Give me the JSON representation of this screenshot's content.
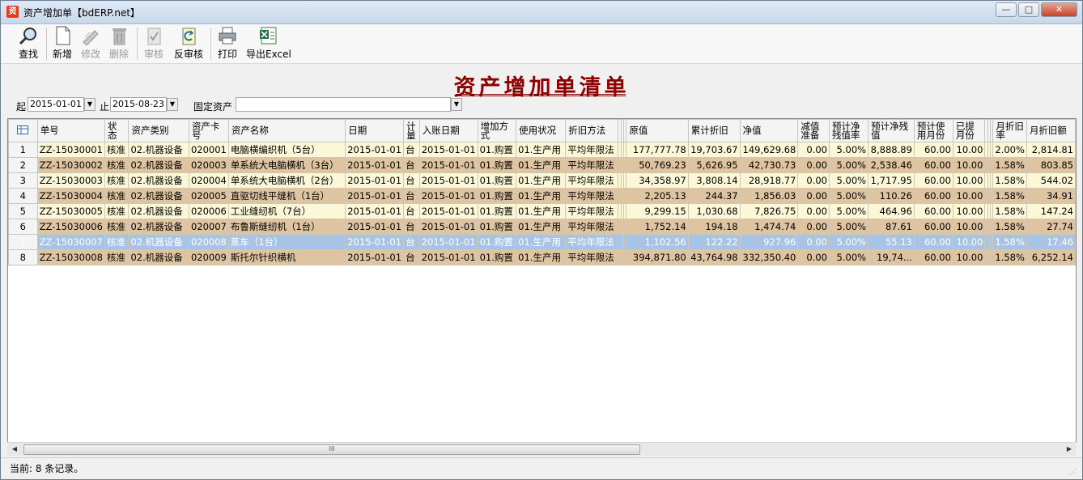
{
  "window": {
    "title": "资产增加单【bdERP.net】",
    "app_icon": "资"
  },
  "toolbar": {
    "search": "查找",
    "new": "新增",
    "edit": "修改",
    "delete": "删除",
    "audit": "审核",
    "unaudit": "反审核",
    "print": "打印",
    "export": "导出Excel"
  },
  "page_title": "资产增加单清单",
  "filter": {
    "from_label": "起",
    "from_value": "2015-01-01",
    "to_label": "止",
    "to_value": "2015-08-23",
    "asset_label": "固定资产",
    "asset_value": ""
  },
  "table": {
    "headers": {
      "no": "单号",
      "status": "状态",
      "category": "资产类别",
      "card": "资产卡号",
      "name": "资产名称",
      "date": "日期",
      "unit": "计量",
      "post_date": "入账日期",
      "method": "增加方式",
      "use_status": "使用状况",
      "depr_method": "折旧方法",
      "orig": "原值",
      "accum": "累计折旧",
      "net": "净值",
      "impair": "减值准备",
      "res_rate": "预计净残值率",
      "res_val": "预计净残值",
      "months": "预计使用月份",
      "used": "已提月份",
      "mrate": "月折旧率",
      "mamt": "月折旧额"
    },
    "rows": [
      {
        "idx": "1",
        "no": "ZZ-15030001",
        "status": "核准",
        "category": "02.机器设备",
        "card": "020001",
        "name": "电脑横编织机（5台）",
        "date": "2015-01-01",
        "unit": "台",
        "post_date": "2015-01-01",
        "method": "01.购置",
        "use_status": "01.生产用",
        "depr_method": "平均年限法",
        "orig": "177,777.78",
        "accum": "19,703.67",
        "net": "149,629.68",
        "impair": "0.00",
        "res_rate": "5.00%",
        "res_val": "8,888.89",
        "months": "60.00",
        "used": "10.00",
        "mrate": "2.00%",
        "mamt": "2,814.81",
        "style": "light"
      },
      {
        "idx": "2",
        "no": "ZZ-15030002",
        "status": "核准",
        "category": "02.机器设备",
        "card": "020003",
        "name": "单系统大电脑横机（3台）",
        "date": "2015-01-01",
        "unit": "台",
        "post_date": "2015-01-01",
        "method": "01.购置",
        "use_status": "01.生产用",
        "depr_method": "平均年限法",
        "orig": "50,769.23",
        "accum": "5,626.95",
        "net": "42,730.73",
        "impair": "0.00",
        "res_rate": "5.00%",
        "res_val": "2,538.46",
        "months": "60.00",
        "used": "10.00",
        "mrate": "1.58%",
        "mamt": "803.85",
        "style": "dark"
      },
      {
        "idx": "3",
        "no": "ZZ-15030003",
        "status": "核准",
        "category": "02.机器设备",
        "card": "020004",
        "name": "单系统大电脑横机（2台）",
        "date": "2015-01-01",
        "unit": "台",
        "post_date": "2015-01-01",
        "method": "01.购置",
        "use_status": "01.生产用",
        "depr_method": "平均年限法",
        "orig": "34,358.97",
        "accum": "3,808.14",
        "net": "28,918.77",
        "impair": "0.00",
        "res_rate": "5.00%",
        "res_val": "1,717.95",
        "months": "60.00",
        "used": "10.00",
        "mrate": "1.58%",
        "mamt": "544.02",
        "style": "light"
      },
      {
        "idx": "4",
        "no": "ZZ-15030004",
        "status": "核准",
        "category": "02.机器设备",
        "card": "020005",
        "name": "直驱切线平缝机（1台）",
        "date": "2015-01-01",
        "unit": "台",
        "post_date": "2015-01-01",
        "method": "01.购置",
        "use_status": "01.生产用",
        "depr_method": "平均年限法",
        "orig": "2,205.13",
        "accum": "244.37",
        "net": "1,856.03",
        "impair": "0.00",
        "res_rate": "5.00%",
        "res_val": "110.26",
        "months": "60.00",
        "used": "10.00",
        "mrate": "1.58%",
        "mamt": "34.91",
        "style": "dark"
      },
      {
        "idx": "5",
        "no": "ZZ-15030005",
        "status": "核准",
        "category": "02.机器设备",
        "card": "020006",
        "name": "工业缝纫机（7台）",
        "date": "2015-01-01",
        "unit": "台",
        "post_date": "2015-01-01",
        "method": "01.购置",
        "use_status": "01.生产用",
        "depr_method": "平均年限法",
        "orig": "9,299.15",
        "accum": "1,030.68",
        "net": "7,826.75",
        "impair": "0.00",
        "res_rate": "5.00%",
        "res_val": "464.96",
        "months": "60.00",
        "used": "10.00",
        "mrate": "1.58%",
        "mamt": "147.24",
        "style": "light"
      },
      {
        "idx": "6",
        "no": "ZZ-15030006",
        "status": "核准",
        "category": "02.机器设备",
        "card": "020007",
        "name": "布鲁斯缝纫机（1台）",
        "date": "2015-01-01",
        "unit": "台",
        "post_date": "2015-01-01",
        "method": "01.购置",
        "use_status": "01.生产用",
        "depr_method": "平均年限法",
        "orig": "1,752.14",
        "accum": "194.18",
        "net": "1,474.74",
        "impair": "0.00",
        "res_rate": "5.00%",
        "res_val": "87.61",
        "months": "60.00",
        "used": "10.00",
        "mrate": "1.58%",
        "mamt": "27.74",
        "style": "dark"
      },
      {
        "idx": "7",
        "no": "ZZ-15030007",
        "status": "核准",
        "category": "02.机器设备",
        "card": "020008",
        "name": "蒸车（1台）",
        "date": "2015-01-01",
        "unit": "台",
        "post_date": "2015-01-01",
        "method": "01.购置",
        "use_status": "01.生产用",
        "depr_method": "平均年限法",
        "orig": "1,102.56",
        "accum": "122.22",
        "net": "927.96",
        "impair": "0.00",
        "res_rate": "5.00%",
        "res_val": "55.13",
        "months": "60.00",
        "used": "10.00",
        "mrate": "1.58%",
        "mamt": "17.46",
        "style": "sel"
      },
      {
        "idx": "8",
        "no": "ZZ-15030008",
        "status": "核准",
        "category": "02.机器设备",
        "card": "020009",
        "name": "斯托尔针织横机",
        "date": "2015-01-01",
        "unit": "台",
        "post_date": "2015-01-01",
        "method": "01.购置",
        "use_status": "01.生产用",
        "depr_method": "平均年限法",
        "orig": "394,871.80",
        "accum": "43,764.98",
        "net": "332,350.40",
        "impair": "0.00",
        "res_rate": "5.00%",
        "res_val": "19,74...",
        "months": "60.00",
        "used": "10.00",
        "mrate": "1.58%",
        "mamt": "6,252.14",
        "style": "dark"
      }
    ]
  },
  "scrollbar": {
    "thumb_grip": "III"
  },
  "status": {
    "text": "当前: 8 条记录。"
  }
}
